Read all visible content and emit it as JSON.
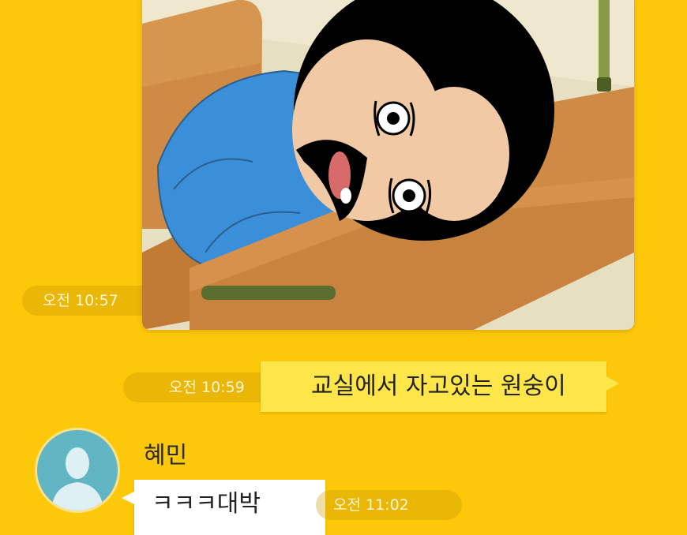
{
  "messages": [
    {
      "type": "image",
      "direction": "outgoing",
      "time": "오전 10:57",
      "icon": "classroom-cartoon-image"
    },
    {
      "type": "text",
      "direction": "outgoing",
      "time": "오전 10:59",
      "text": "교실에서 자고있는 원숭이"
    },
    {
      "type": "text",
      "direction": "incoming",
      "sender": "혜민",
      "time": "오전 11:02",
      "text": "ㅋㅋㅋ대박",
      "avatar_icon": "default-person-icon"
    }
  ],
  "colors": {
    "background": "#fdc80a",
    "outgoing_bubble": "#fde54a",
    "incoming_bubble": "#ffffff",
    "avatar": "#62b6c4"
  }
}
